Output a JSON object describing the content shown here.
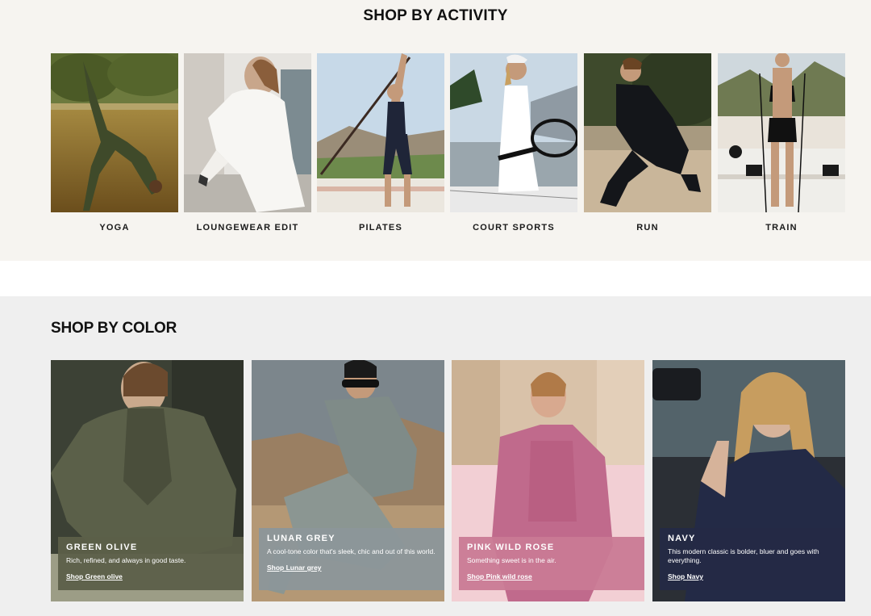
{
  "activity": {
    "title": "SHOP BY ACTIVITY",
    "cards": [
      {
        "label": "YOGA"
      },
      {
        "label": "LOUNGEWEAR EDIT"
      },
      {
        "label": "PILATES"
      },
      {
        "label": "COURT SPORTS"
      },
      {
        "label": "RUN"
      },
      {
        "label": "TRAIN"
      }
    ]
  },
  "color": {
    "title": "SHOP BY COLOR",
    "cards": [
      {
        "name": "GREEN OLIVE",
        "desc": "Rich, refined, and always in good taste.",
        "link": "Shop Green olive",
        "swatch": "#5c5f49"
      },
      {
        "name": "LUNAR GREY",
        "desc": "A cool-tone color that's sleek, chic and out of this world.",
        "link": "Shop Lunar grey",
        "swatch": "#8c969a"
      },
      {
        "name": "PINK WILD ROSE",
        "desc": "Something sweet is in the air.",
        "link": "Shop Pink wild rose",
        "swatch": "#c97a95"
      },
      {
        "name": "NAVY",
        "desc": "This modern classic is bolder, bluer and goes with everything.",
        "link": "Shop Navy",
        "swatch": "#242a45"
      }
    ]
  }
}
